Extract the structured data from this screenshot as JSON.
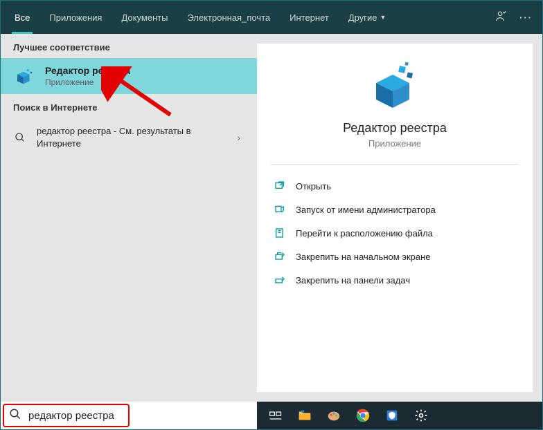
{
  "tabs": {
    "all": "Все",
    "apps": "Приложения",
    "documents": "Документы",
    "email": "Электронная_почта",
    "internet": "Интернет",
    "other": "Другие"
  },
  "sections": {
    "best_match": "Лучшее соответствие",
    "web_search": "Поиск в Интернете"
  },
  "best_result": {
    "title": "Редактор реестра",
    "subtitle": "Приложение"
  },
  "web_result": {
    "title": "редактор реестра",
    "hint": " - См. результаты в Интернете"
  },
  "preview": {
    "title": "Редактор реестра",
    "subtitle": "Приложение"
  },
  "actions": {
    "open": "Открыть",
    "run_admin": "Запуск от имени администратора",
    "open_location": "Перейти к расположению файла",
    "pin_start": "Закрепить на начальном экране",
    "pin_taskbar": "Закрепить на панели задач"
  },
  "search": {
    "value": "редактор реестра"
  },
  "colors": {
    "accent": "#3fc7d0",
    "header_bg": "#1a4045",
    "selected_bg": "#7fd7db",
    "action_icon": "#0099a8"
  }
}
